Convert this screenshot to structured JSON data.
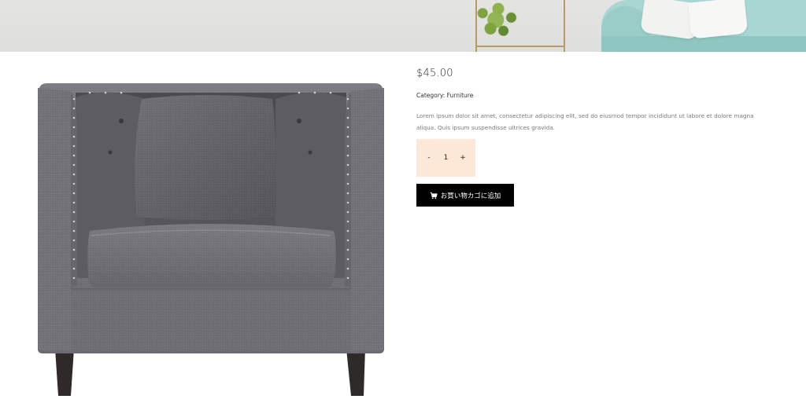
{
  "product": {
    "price": "$45.00",
    "category_label": "Category:",
    "category_value": "Furniture",
    "description": "Lorem ipsum dolor sit amet, consectetur adipiscing elit, sed do eiusmod tempor incididunt ut labore et dolore magna aliqua. Quis ipsum suspendisse ultrices gravida.",
    "image_subject": "gray tufted armchair"
  },
  "quantity": {
    "minus_label": "-",
    "value": "1",
    "plus_label": "+"
  },
  "cart_button": {
    "label": "お買い物カゴに追加",
    "icon": "shopping-cart-icon"
  },
  "colors": {
    "button_bg": "#000000",
    "button_text": "#ffffff",
    "quantity_bg": "#fde8d7",
    "description_text": "#7a7a7a"
  }
}
